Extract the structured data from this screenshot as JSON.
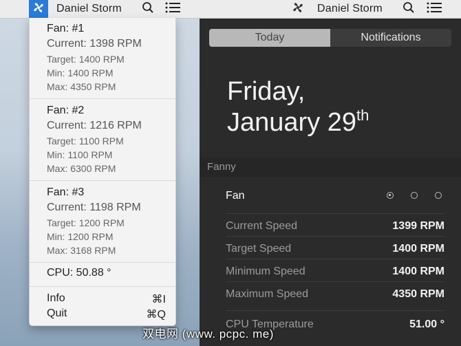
{
  "menubar_left": {
    "user": "Daniel Storm"
  },
  "menubar_right": {
    "user": "Daniel Storm"
  },
  "fan_menu": {
    "fans": [
      {
        "title": "Fan: #1",
        "current": "Current: 1398 RPM",
        "target": "Target: 1400 RPM",
        "min": "Min: 1400 RPM",
        "max": "Max: 4350 RPM"
      },
      {
        "title": "Fan: #2",
        "current": "Current: 1216 RPM",
        "target": "Target: 1100 RPM",
        "min": "Min: 1100 RPM",
        "max": "Max: 6300 RPM"
      },
      {
        "title": "Fan: #3",
        "current": "Current: 1198 RPM",
        "target": "Target: 1200 RPM",
        "min": "Min: 1200 RPM",
        "max": "Max: 3168 RPM"
      }
    ],
    "cpu": "CPU: 50.88 °",
    "info_label": "Info",
    "info_shortcut": "⌘I",
    "quit_label": "Quit",
    "quit_shortcut": "⌘Q"
  },
  "notification_center": {
    "tabs": {
      "today": "Today",
      "notifications": "Notifications"
    },
    "date_day": "Friday,",
    "date_month_day": "January 29",
    "date_suffix": "th",
    "section": "Fanny",
    "widget": {
      "title": "Fan",
      "rows": [
        {
          "label": "Current Speed",
          "value": "1399 RPM"
        },
        {
          "label": "Target Speed",
          "value": "1400 RPM"
        },
        {
          "label": "Minimum Speed",
          "value": "1400 RPM"
        },
        {
          "label": "Maximum Speed",
          "value": "4350 RPM"
        },
        {
          "label": "CPU Temperature",
          "value": "51.00 °"
        }
      ]
    }
  },
  "watermark": "双电网 (www. pcpc. me)",
  "colors": {
    "accent": "#2a7bd8",
    "nc_bg": "#2b2b2b",
    "menu_bg": "#f3f3f3"
  },
  "icons": [
    "fan-icon",
    "search-icon",
    "list-icon"
  ]
}
